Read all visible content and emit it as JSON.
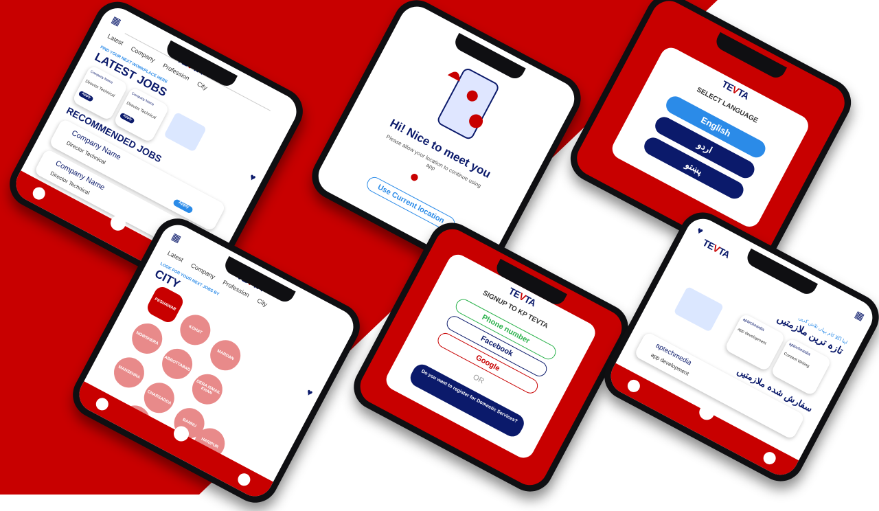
{
  "colors": {
    "brand_red": "#c80000",
    "brand_navy": "#0b1a6b",
    "accent_blue": "#2b8be8",
    "bubble_pink": "#e88a8a"
  },
  "brand": {
    "logo_prefix": "TE",
    "logo_v": "V",
    "logo_suffix": "TA"
  },
  "jobs_screen": {
    "tabs": [
      "Latest",
      "Company",
      "Profession",
      "City"
    ],
    "tagline": "FIND YOUR NEXT WORKPLACE HERE",
    "title_latest": "LATEST JOBS",
    "title_recommended": "RECOMMENDED JOBS",
    "company_name": "Company Name",
    "small_company": "Company Name",
    "job_title": "Director Technical",
    "apply_label": "Apply"
  },
  "location_screen": {
    "greeting": "Hi! Nice to meet you",
    "subtext": "Please allow your location to continue using app",
    "button": "Use Current location"
  },
  "language_screen": {
    "title": "SELECT LANGUAGE",
    "options": [
      "English",
      "اردو",
      "پښتو"
    ]
  },
  "city_screen": {
    "tabs": [
      "Latest",
      "Company",
      "Profession",
      "City"
    ],
    "tagline": "LOOK FOR YOUR NEXT JOBS BY",
    "title": "CITY",
    "cities": [
      "PESHAWAR",
      "KOHAT",
      "MARDAN",
      "NOWSHERA",
      "ABBOTTABAD",
      "DERA ISMAIL KHAN",
      "MANSEHRA",
      "CHARSADDA",
      "BANNU",
      "SWAT",
      "SWABI",
      "HARIPUR"
    ]
  },
  "signup_screen": {
    "title": "SIGNUP TO KP TEVTA",
    "options": [
      "Phone number",
      "Facebook",
      "Google"
    ],
    "or": "OR",
    "register_text": "Do you want to register for Domestic Services?"
  },
  "urdu_screen": {
    "tagline": "اپنا اگلا کام یہاں تلاش کریں",
    "title_latest": "تازہ ترین ملازمتیں",
    "title_recommended": "سفارش شدہ ملازمتیں",
    "company": "aptechmedia",
    "job1": "app development",
    "job2": "Content Writing",
    "apply_label": "Apply"
  }
}
